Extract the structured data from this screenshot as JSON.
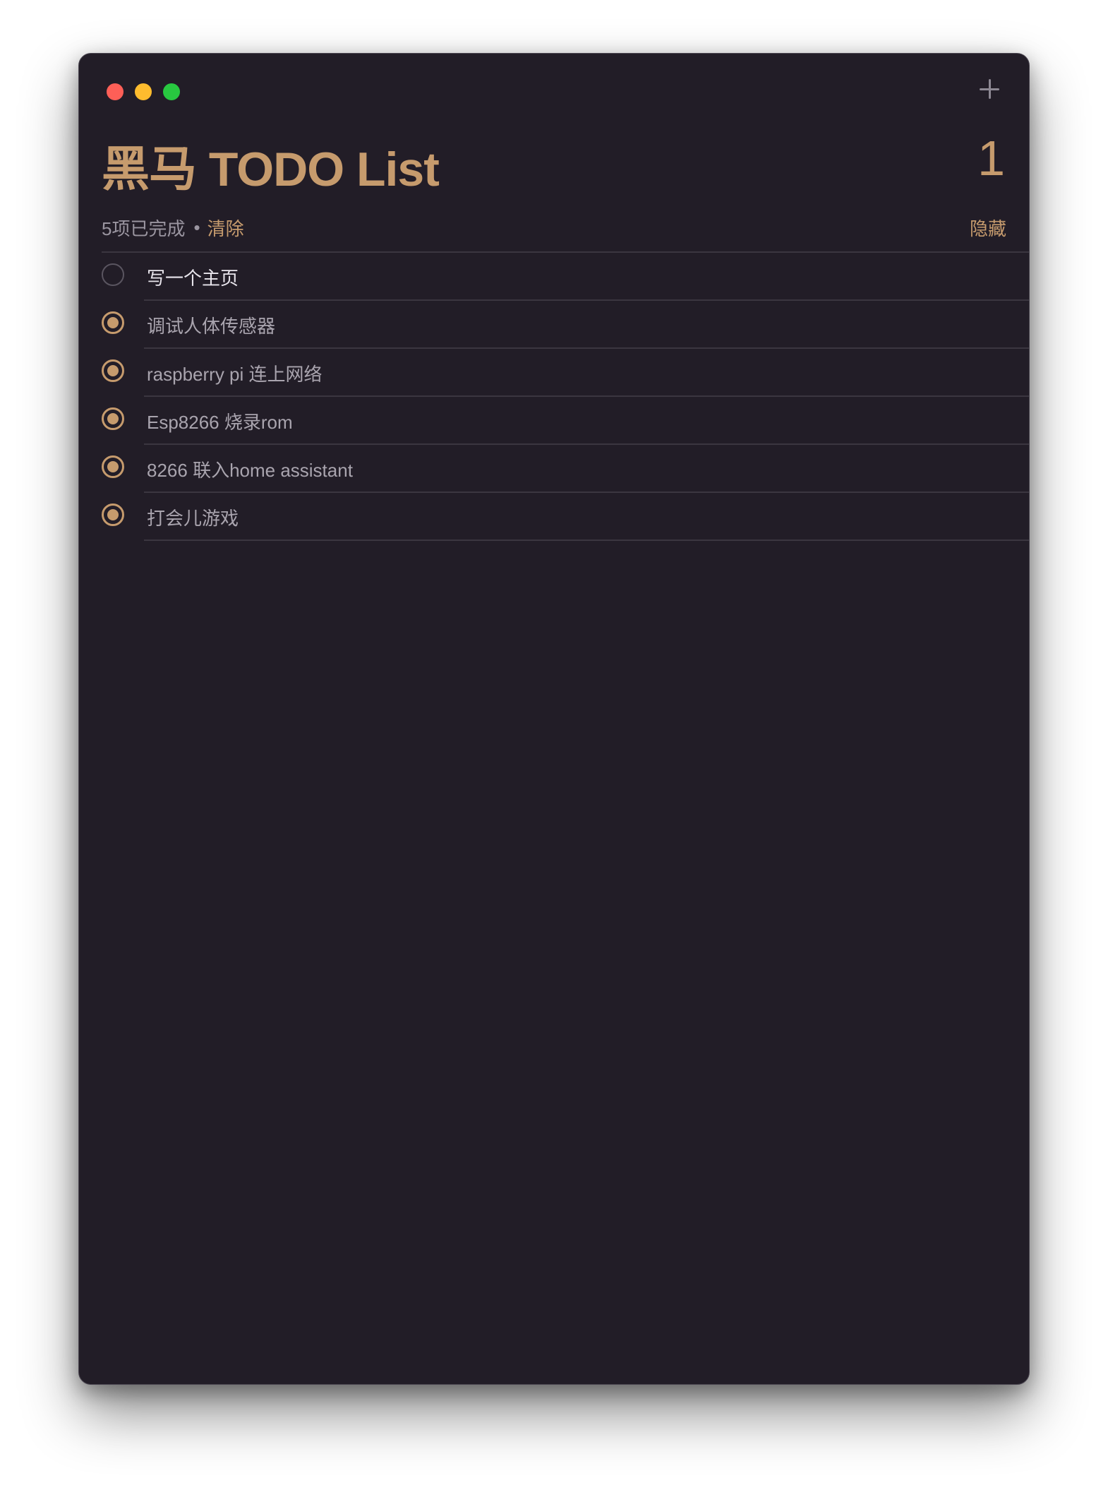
{
  "window": {
    "title": "黑马 TODO List",
    "count": "1"
  },
  "toolbar": {
    "add_icon": "plus-icon"
  },
  "summary": {
    "completed_text": "5项已完成",
    "separator": "•",
    "clear_label": "清除",
    "hide_label": "隐藏"
  },
  "todos": [
    {
      "text": "写一个主页",
      "done": false
    },
    {
      "text": "调试人体传感器",
      "done": true
    },
    {
      "text": "raspberry pi  连上网络",
      "done": true
    },
    {
      "text": "Esp8266 烧录rom",
      "done": true
    },
    {
      "text": "8266 联入home assistant",
      "done": true
    },
    {
      "text": "打会儿游戏",
      "done": true
    }
  ],
  "colors": {
    "background": "#221d27",
    "accent": "#c69b6d",
    "text_muted": "#a9a4ae",
    "text_active": "#e8e5ec"
  }
}
